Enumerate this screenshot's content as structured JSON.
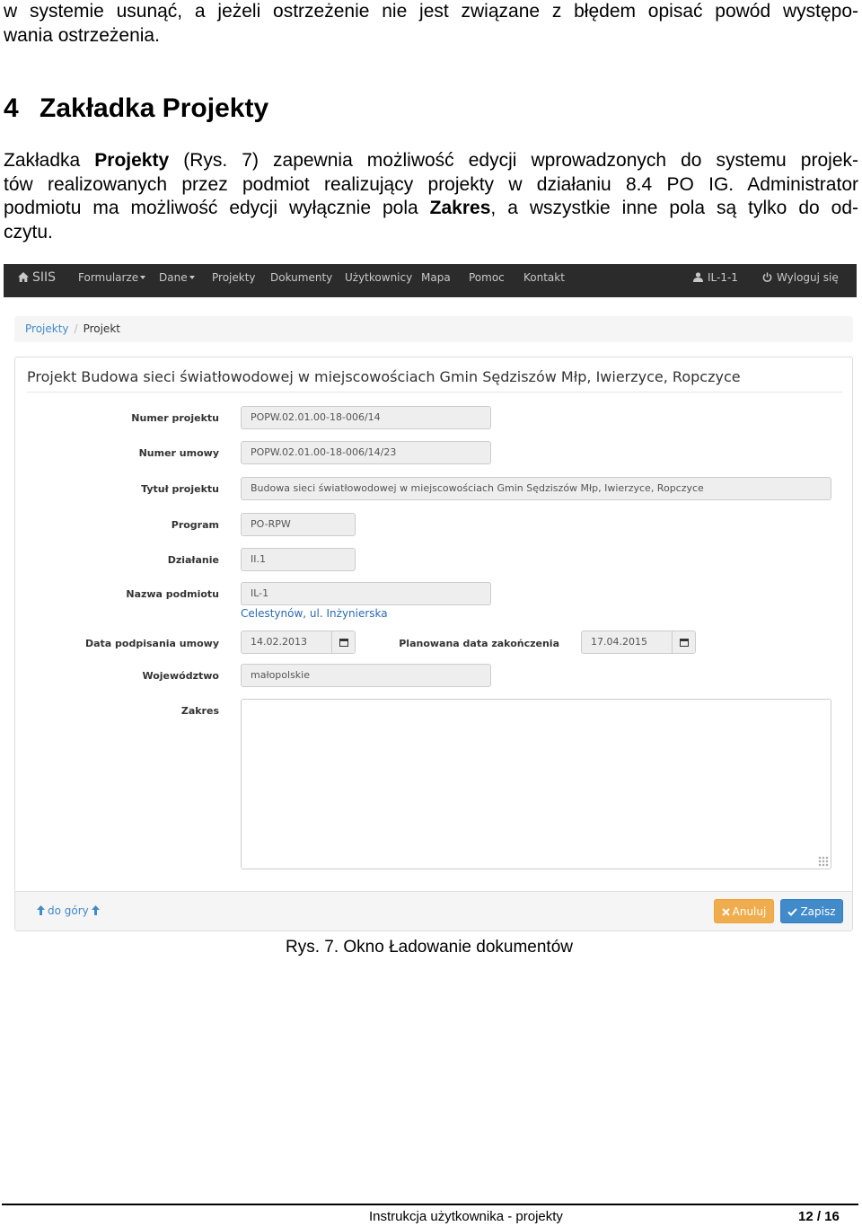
{
  "intro": {
    "line1": "w systemie usunąć, a jeżeli ostrzeżenie nie jest związane z błędem opisać powód występo-",
    "line2": "wania ostrzeżenia."
  },
  "heading": {
    "number": "4",
    "title": "Zakładka Projekty"
  },
  "paragraph": {
    "l1a": "Zakładka ",
    "l1b": "Projekty",
    "l1c": " (Rys. 7) zapewnia możliwość edycji wprowadzonych do systemu projek-",
    "l2": "tów realizowanych przez podmiot realizujący projekty w działaniu 8.4 PO IG. Administrator",
    "l3a": "podmiotu ma możliwość edycji wyłącznie pola ",
    "l3b": "Zakres",
    "l3c": ", a wszystkie inne pola są tylko do od-",
    "l4": "czytu."
  },
  "navbar": {
    "brand": "SIIS",
    "items": [
      "Formularze",
      "Dane",
      "Projekty",
      "Dokumenty",
      "Użytkownicy",
      "Mapa",
      "Pomoc",
      "Kontakt"
    ],
    "user": "IL-1-1",
    "logout": "Wyloguj się"
  },
  "breadcrumb": {
    "link": "Projekty",
    "separator": "/",
    "current": "Projekt"
  },
  "panel": {
    "title": "Projekt Budowa sieci światłowodowej w miejscowościach Gmin Sędziszów Młp, Iwierzyce, Ropczyce",
    "fields": {
      "numer_projektu": {
        "label": "Numer projektu",
        "value": "POPW.02.01.00-18-006/14"
      },
      "numer_umowy": {
        "label": "Numer umowy",
        "value": "POPW.02.01.00-18-006/14/23"
      },
      "tytul_projektu": {
        "label": "Tytuł projektu",
        "value": "Budowa sieci światłowodowej w miejscowościach Gmin Sędziszów Młp, Iwierzyce, Ropczyce"
      },
      "program": {
        "label": "Program",
        "value": "PO-RPW"
      },
      "dzialanie": {
        "label": "Działanie",
        "value": "II.1"
      },
      "nazwa_podmiotu": {
        "label": "Nazwa podmiotu",
        "value": "IL-1",
        "address": "Celestynów, ul. Inżynierska"
      },
      "data_podpisania": {
        "label": "Data podpisania umowy",
        "value": "14.02.2013"
      },
      "planowana_data": {
        "label": "Planowana data zakończenia",
        "value": "17.04.2015"
      },
      "wojewodztwo": {
        "label": "Województwo",
        "value": "małopolskie"
      },
      "zakres": {
        "label": "Zakres",
        "value": ""
      }
    },
    "footer": {
      "to_top": "do góry",
      "cancel": "Anuluj",
      "save": "Zapisz"
    }
  },
  "caption": "Rys. 7. Okno Ładowanie dokumentów",
  "page_footer": {
    "title": "Instrukcja użytkownika - projekty",
    "page": "12 / 16"
  },
  "colors": {
    "navbar": "#2b2b2b",
    "link": "#428bca",
    "cancel": "#f0ad4e",
    "save": "#428bca"
  }
}
